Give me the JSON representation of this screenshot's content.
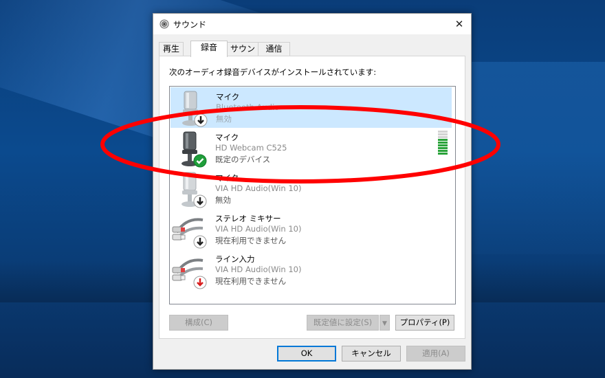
{
  "window": {
    "title": "サウンド",
    "close_glyph": "✕"
  },
  "tabs": [
    {
      "label": "再生",
      "active": false
    },
    {
      "label": "録音",
      "active": true
    },
    {
      "label": "サウンド",
      "active": false
    },
    {
      "label": "通信",
      "active": false
    }
  ],
  "panel": {
    "description": "次のオーディオ録音デバイスがインストールされています:"
  },
  "devices": [
    {
      "name": "マイク",
      "driver": "Bluetooth Audio",
      "status": "無効",
      "icon": "microphone-disabled-icon",
      "selected": true
    },
    {
      "name": "マイク",
      "driver": "HD Webcam C525",
      "status": "既定のデバイス",
      "icon": "webcam-microphone-default-icon",
      "selected": false,
      "level": 0.75
    },
    {
      "name": "マイク",
      "driver": "VIA HD Audio(Win 10)",
      "status": "無効",
      "icon": "microphone-disabled-icon",
      "selected": false
    },
    {
      "name": "ステレオ ミキサー",
      "driver": "VIA HD Audio(Win 10)",
      "status": "現在利用できません",
      "icon": "rca-cable-unavailable-icon",
      "selected": false
    },
    {
      "name": "ライン入力",
      "driver": "VIA HD Audio(Win 10)",
      "status": "現在利用できません",
      "icon": "rca-cable-unplugged-icon",
      "selected": false
    }
  ],
  "panel_buttons": {
    "configure": "構成(C)",
    "set_default": "既定値に設定(S)",
    "properties": "プロパティ(P)"
  },
  "dialog_buttons": {
    "ok": "OK",
    "cancel": "キャンセル",
    "apply": "適用(A)"
  },
  "colors": {
    "selection": "#cce8ff",
    "annotation": "#ff0000",
    "level_on": "#2aa33a",
    "default_check": "#1f9e3a"
  }
}
